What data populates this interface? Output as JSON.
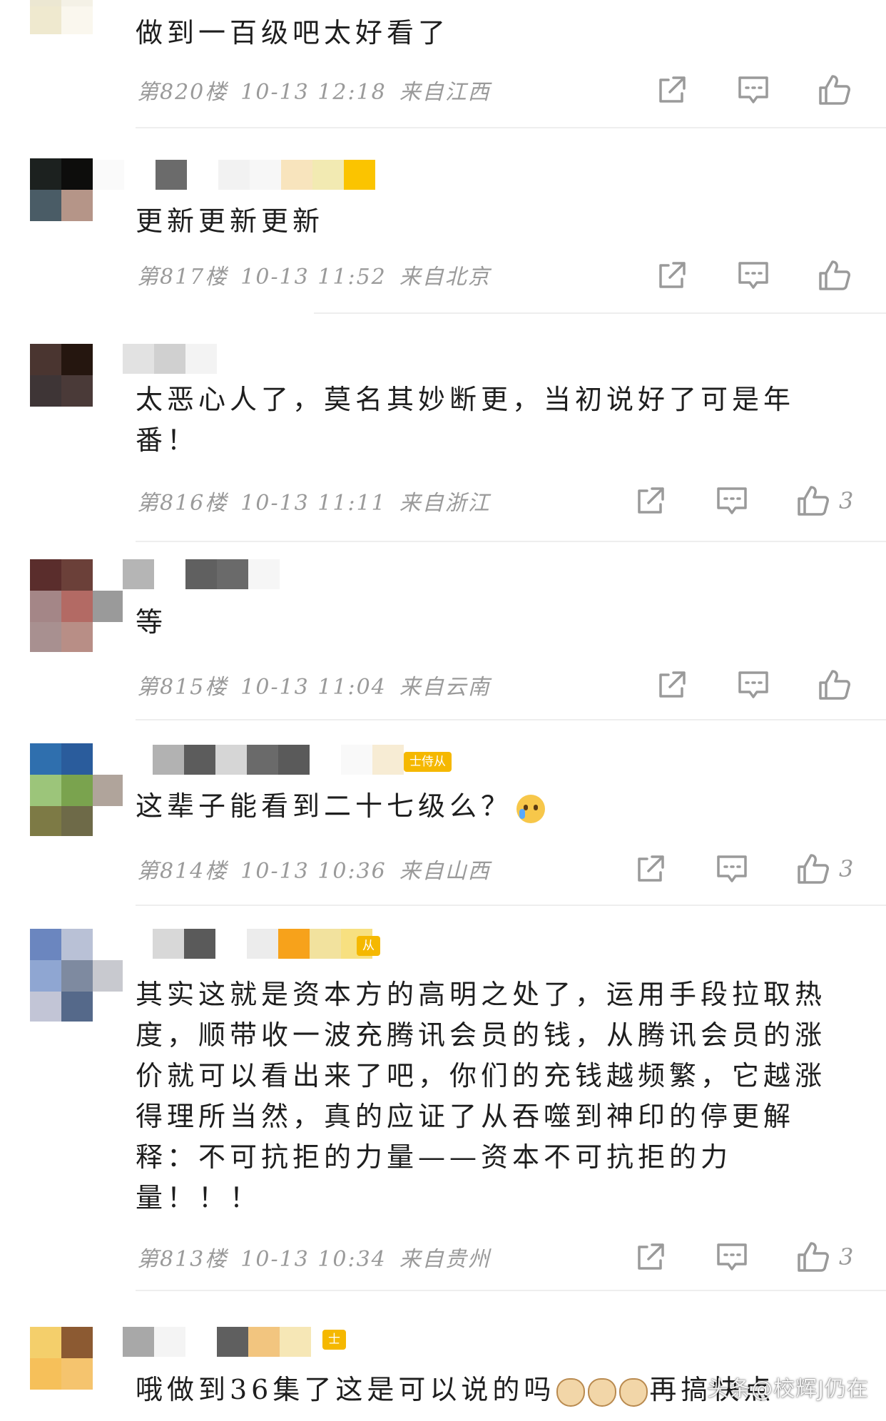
{
  "comments": [
    {
      "text": "做到一百级吧太好看了",
      "floor": "第820楼",
      "time": "10-13 12:18",
      "location": "来自江西",
      "likes": ""
    },
    {
      "text": "更新更新更新",
      "floor": "第817楼",
      "time": "10-13 11:52",
      "location": "来自北京",
      "likes": ""
    },
    {
      "text": "太恶心人了，莫名其妙断更，当初说好了可是年番！",
      "floor": "第816楼",
      "time": "10-13 11:11",
      "location": "来自浙江",
      "likes": "3"
    },
    {
      "text": "等",
      "floor": "第815楼",
      "time": "10-13 11:04",
      "location": "来自云南",
      "likes": ""
    },
    {
      "text": "这辈子能看到二十七级么？",
      "floor": "第814楼",
      "time": "10-13 10:36",
      "location": "来自山西",
      "likes": "3",
      "badge": "士侍从"
    },
    {
      "text": "其实这就是资本方的高明之处了，运用手段拉取热度，顺带收一波充腾讯会员的钱，从腾讯会员的涨价就可以看出来了吧，你们的充钱越频繁，它越涨得理所当然，真的应证了从吞噬到神印的停更解释：不可抗拒的力量——资本不可抗拒的力量！！！",
      "floor": "第813楼",
      "time": "10-13 10:34",
      "location": "来自贵州",
      "likes": "3",
      "badge": "从"
    },
    {
      "text": "哦做到36集了这是可以说的吗",
      "text_tail": "再搞快点",
      "badge": "士"
    }
  ],
  "icons": {
    "share": "share-icon",
    "reply": "reply-icon",
    "like": "thumbs-up-icon"
  },
  "colors": {
    "meta_gray": "#9a9a9a",
    "badge_gold": "#f5b800",
    "divider": "#eeeeee"
  },
  "watermark": "头条@校辉J仍在"
}
